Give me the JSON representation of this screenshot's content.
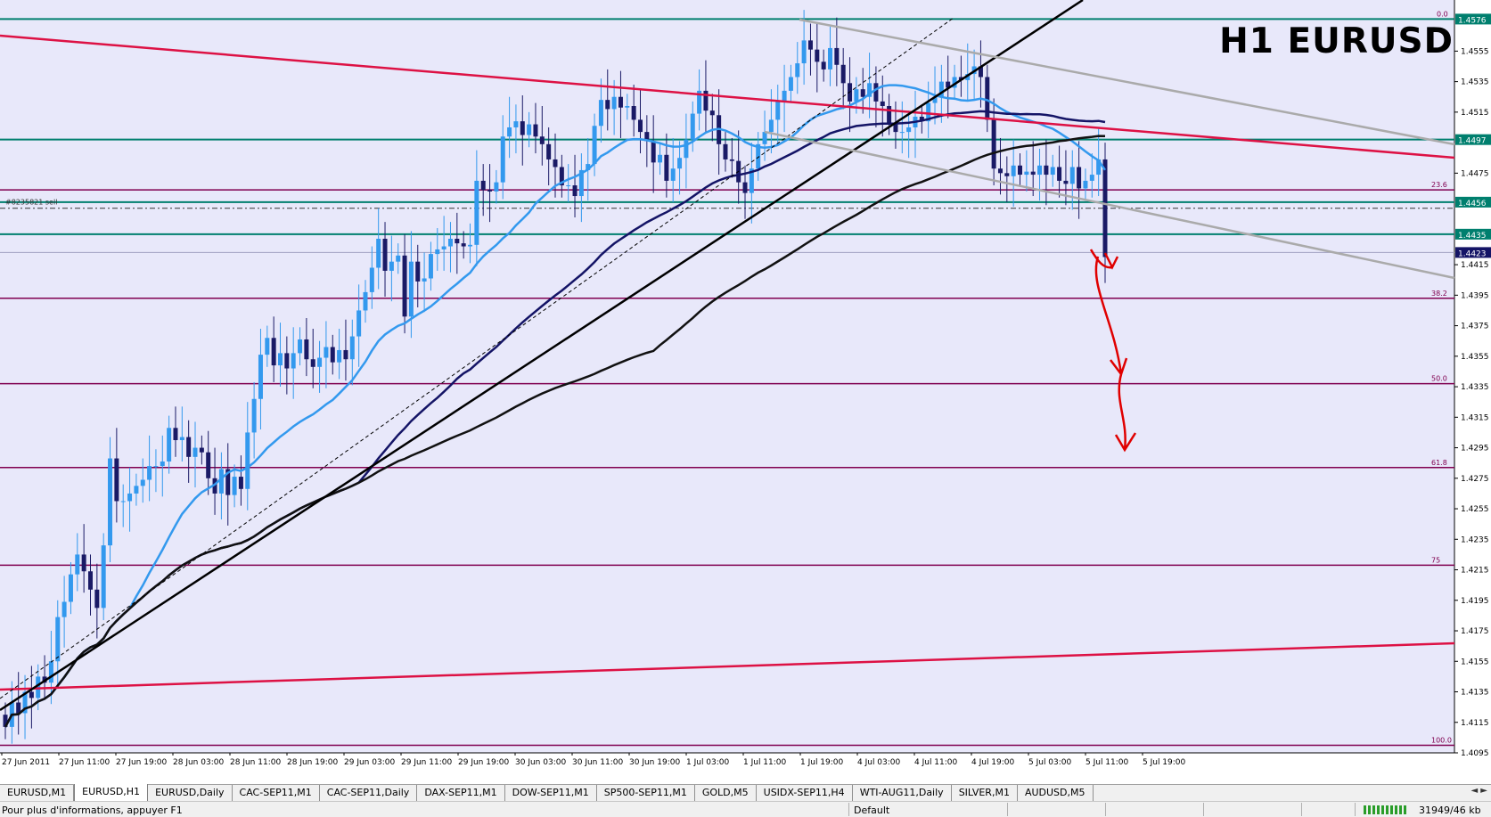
{
  "chart_title": "H1 EURUSD",
  "colors": {
    "background": "#e8e8fa",
    "bull_candle": "#3399ee",
    "bear_candle": "#1a1a66",
    "support_line": "#007f6e",
    "fib_line": "#800050",
    "trend_red": "#dd1144",
    "ma_fast": "#3399ee",
    "ma_mid": "#141466",
    "ma_slow": "#111111",
    "price_label_bg": "#007f6e",
    "current_price_bg": "#141466",
    "arrow_annotation": "#e00000"
  },
  "chart_data": {
    "type": "candlestick",
    "symbol": "EURUSD",
    "timeframe": "H1",
    "ylim": [
      1.4095,
      1.4585
    ],
    "y_ticks": [
      "1.4555",
      "1.4535",
      "1.4515",
      "1.4475",
      "1.4415",
      "1.4395",
      "1.4375",
      "1.4355",
      "1.4335",
      "1.4315",
      "1.4295",
      "1.4275",
      "1.4255",
      "1.4235",
      "1.4215",
      "1.4195",
      "1.4175",
      "1.4155",
      "1.4135",
      "1.4115",
      "1.4095"
    ],
    "x_labels": [
      "27 Jun 2011",
      "27 Jun 11:00",
      "27 Jun 19:00",
      "28 Jun 03:00",
      "28 Jun 11:00",
      "28 Jun 19:00",
      "29 Jun 03:00",
      "29 Jun 11:00",
      "29 Jun 19:00",
      "30 Jun 03:00",
      "30 Jun 11:00",
      "30 Jun 19:00",
      "1 Jul 03:00",
      "1 Jul 11:00",
      "1 Jul 19:00",
      "4 Jul 03:00",
      "4 Jul 11:00",
      "4 Jul 19:00",
      "5 Jul 03:00",
      "5 Jul 11:00",
      "5 Jul 19:00"
    ],
    "horizontal_levels": [
      {
        "price": 1.4576,
        "label": "1.4576",
        "fib": "0.0"
      },
      {
        "price": 1.4497,
        "label": "1.4497"
      },
      {
        "price": 1.4456,
        "label": "1.4456"
      },
      {
        "price": 1.4435,
        "label": "1.4435"
      }
    ],
    "fib_levels": [
      {
        "price": 1.4464,
        "label": "23.6"
      },
      {
        "price": 1.4393,
        "label": "38.2"
      },
      {
        "price": 1.4337,
        "label": "50.0"
      },
      {
        "price": 1.4282,
        "label": "61.8"
      },
      {
        "price": 1.4218,
        "label": "75"
      },
      {
        "price": 1.41,
        "label": "100.0"
      }
    ],
    "current_price": "1.4423",
    "order_label": "#8235821 sell",
    "closes": [
      1.4112,
      1.4128,
      1.4121,
      1.4135,
      1.4131,
      1.4145,
      1.4141,
      1.4155,
      1.4184,
      1.4194,
      1.4212,
      1.4225,
      1.4214,
      1.4202,
      1.419,
      1.4231,
      1.4288,
      1.426,
      1.426,
      1.4265,
      1.427,
      1.4274,
      1.4283,
      1.4283,
      1.4286,
      1.4308,
      1.43,
      1.4302,
      1.4289,
      1.4295,
      1.4292,
      1.4275,
      1.4265,
      1.4281,
      1.4264,
      1.4276,
      1.4268,
      1.4305,
      1.4327,
      1.4356,
      1.4367,
      1.4349,
      1.4357,
      1.4347,
      1.4357,
      1.4366,
      1.4353,
      1.4348,
      1.4354,
      1.4361,
      1.4351,
      1.4359,
      1.4353,
      1.4368,
      1.4385,
      1.4397,
      1.4413,
      1.4432,
      1.4411,
      1.4417,
      1.4421,
      1.4381,
      1.4417,
      1.4404,
      1.4406,
      1.4422,
      1.4425,
      1.4427,
      1.4432,
      1.4429,
      1.4427,
      1.4428,
      1.447,
      1.4464,
      1.4463,
      1.4469,
      1.4499,
      1.4505,
      1.4509,
      1.45,
      1.4507,
      1.4499,
      1.4494,
      1.4484,
      1.4479,
      1.4467,
      1.4467,
      1.446,
      1.4477,
      1.4481,
      1.4506,
      1.4523,
      1.4517,
      1.4525,
      1.4518,
      1.4519,
      1.451,
      1.4502,
      1.4496,
      1.4482,
      1.4487,
      1.447,
      1.4478,
      1.4485,
      1.4497,
      1.4514,
      1.4529,
      1.4516,
      1.4513,
      1.4494,
      1.4484,
      1.4483,
      1.4469,
      1.4462,
      1.4478,
      1.4494,
      1.4502,
      1.451,
      1.4522,
      1.4529,
      1.4538,
      1.4547,
      1.4562,
      1.4556,
      1.4548,
      1.4543,
      1.4557,
      1.4546,
      1.4534,
      1.4522,
      1.453,
      1.4525,
      1.4534,
      1.4522,
      1.4519,
      1.4508,
      1.4502,
      1.4502,
      1.4505,
      1.4512,
      1.4509,
      1.4521,
      1.4525,
      1.4535,
      1.4531,
      1.4538,
      1.4536,
      1.454,
      1.4545,
      1.4538,
      1.451,
      1.4478,
      1.4475,
      1.4473,
      1.448,
      1.4474,
      1.4476,
      1.4474,
      1.448,
      1.4474,
      1.4479,
      1.447,
      1.4468,
      1.4479,
      1.4465,
      1.447,
      1.4474,
      1.4484,
      1.442
    ]
  },
  "tabs": [
    {
      "label": "EURUSD,M1",
      "active": false
    },
    {
      "label": "EURUSD,H1",
      "active": true
    },
    {
      "label": "EURUSD,Daily",
      "active": false
    },
    {
      "label": "CAC-SEP11,M1",
      "active": false
    },
    {
      "label": "CAC-SEP11,Daily",
      "active": false
    },
    {
      "label": "DAX-SEP11,M1",
      "active": false
    },
    {
      "label": "DOW-SEP11,M1",
      "active": false
    },
    {
      "label": "SP500-SEP11,M1",
      "active": false
    },
    {
      "label": "GOLD,M5",
      "active": false
    },
    {
      "label": "USIDX-SEP11,H4",
      "active": false
    },
    {
      "label": "WTI-AUG11,Daily",
      "active": false
    },
    {
      "label": "SILVER,M1",
      "active": false
    },
    {
      "label": "AUDUSD,M5",
      "active": false
    }
  ],
  "tab_scroll_icons": "◄ ►",
  "status": {
    "help_text": "Pour plus d'informations, appuyer F1",
    "profile": "Default",
    "traffic": "31949/46 kb"
  }
}
